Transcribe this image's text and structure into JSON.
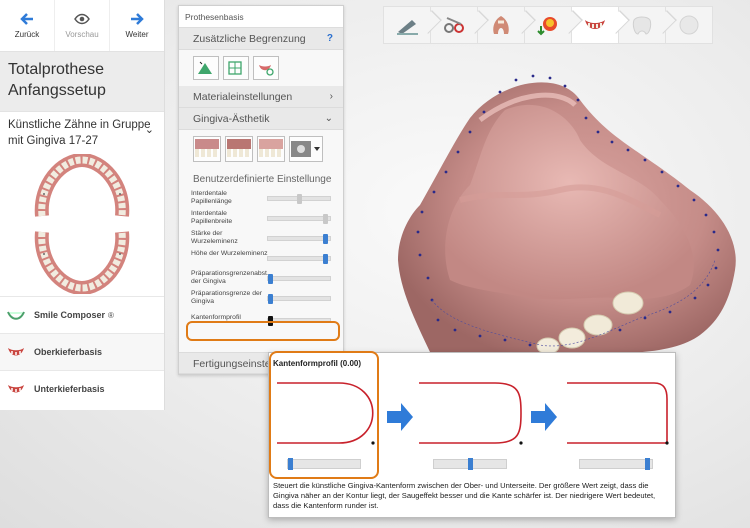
{
  "left_nav": {
    "back_label": "Zurück",
    "preview_label": "Vorschau",
    "next_label": "Weiter"
  },
  "left_panel": {
    "title": "Totalprothese Anfangssetup",
    "subtitle": "Künstliche Zähne in Gruppe mit Gingiva 17-27",
    "items": [
      {
        "label": "Smile Composer",
        "suffix": "®",
        "icon": "smile-composer-icon"
      },
      {
        "label": "Oberkieferbasis",
        "icon": "upper-jaw-base-icon"
      },
      {
        "label": "Unterkieferbasis",
        "icon": "lower-jaw-base-icon"
      }
    ]
  },
  "workflow_steps": [
    {
      "icon": "scan-icon",
      "state": "done"
    },
    {
      "icon": "tools-icon",
      "state": "done"
    },
    {
      "icon": "teeth-setup-icon",
      "state": "done"
    },
    {
      "icon": "tooth-download-icon",
      "state": "done"
    },
    {
      "icon": "denture-base-icon",
      "state": "active"
    },
    {
      "icon": "tooth-outline-icon",
      "state": "disabled"
    },
    {
      "icon": "sphere-icon",
      "state": "disabled"
    }
  ],
  "prothesen_panel": {
    "header": "Prothesenbasis",
    "sections": {
      "zusaetzliche": "Zusätzliche Begrenzung",
      "help": "?",
      "material": "Materialeinstellungen",
      "gingiva": "Gingiva-Ästhetik",
      "benutzer": "Benutzerdefinierte Einstellunge",
      "fertigung": "Fertigungseinste"
    },
    "sliders": [
      {
        "label": "Interdentale Papillenlänge",
        "value": 0.5,
        "state": "grey"
      },
      {
        "label": "Interdentale Papillenbreite",
        "value": 0.95,
        "state": "grey"
      },
      {
        "label": "Stärke der Wurzeleminenz",
        "value": 0.95,
        "state": "blue"
      },
      {
        "label": "Höhe der Wurzeleminenz",
        "value": 0.95,
        "state": "blue"
      },
      {
        "label": "Präparationsgrenzenabst. der Gingiva",
        "value": 0.0,
        "state": "blue"
      },
      {
        "label": "Präparationsgrenze der Gingiva",
        "value": 0.0,
        "state": "blue"
      },
      {
        "label": "Kantenformprofil",
        "value": 0.0,
        "state": "dark"
      }
    ]
  },
  "tooltip": {
    "title": "Kantenformprofil (0.00)",
    "description": "Steuert die künstliche Gingiva-Kantenform zwischen der Ober- und Unterseite. Der größere Wert zeigt, dass die Gingiva näher an der Kontur liegt, der Saugeffekt besser und die Kante schärfer ist. Der niedrigere Wert bedeutet, dass die Kantenform runder ist.",
    "profiles": [
      {
        "slider_value": 0.0
      },
      {
        "slider_value": 0.5
      },
      {
        "slider_value": 0.95
      }
    ]
  },
  "colors": {
    "accent": "#2f7bd8",
    "highlight": "#e07b16",
    "profile_curve": "#c8212b",
    "gingiva": "#c98a8a"
  }
}
